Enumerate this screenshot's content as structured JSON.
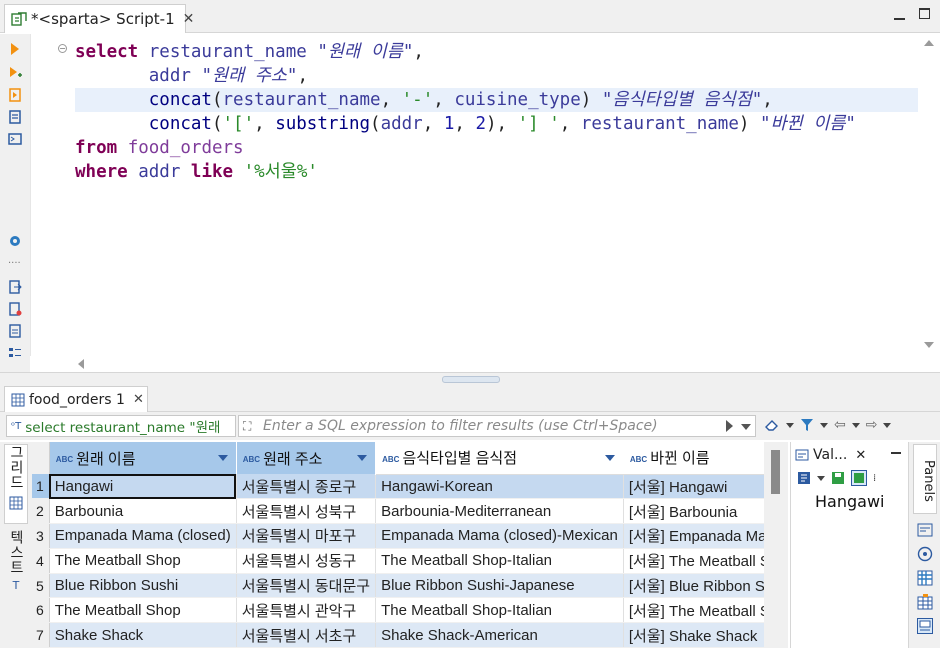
{
  "editor_tab": {
    "title": "*<sparta> Script-1",
    "close": "✕"
  },
  "sql": {
    "lines": [
      [
        {
          "t": "select",
          "c": "kw"
        },
        {
          "t": " restaurant_name ",
          "c": "id"
        },
        {
          "t": "\"원래 이름\"",
          "c": "alias"
        },
        {
          "t": ",",
          "c": "pl"
        }
      ],
      [
        {
          "t": "       addr ",
          "c": "id"
        },
        {
          "t": "\"원래 주소\"",
          "c": "alias"
        },
        {
          "t": ",",
          "c": "pl"
        }
      ],
      [
        {
          "t": "       concat",
          "c": "fn"
        },
        {
          "t": "(",
          "c": "pl"
        },
        {
          "t": "restaurant_name",
          "c": "id"
        },
        {
          "t": ", ",
          "c": "pl"
        },
        {
          "t": "'-'",
          "c": "str"
        },
        {
          "t": ", ",
          "c": "pl"
        },
        {
          "t": "cuisine_type",
          "c": "id"
        },
        {
          "t": ") ",
          "c": "pl"
        },
        {
          "t": "\"음식타입별 음식점\"",
          "c": "alias"
        },
        {
          "t": ",",
          "c": "pl"
        }
      ],
      [
        {
          "t": "       concat",
          "c": "fn"
        },
        {
          "t": "(",
          "c": "pl"
        },
        {
          "t": "'['",
          "c": "str"
        },
        {
          "t": ", ",
          "c": "pl"
        },
        {
          "t": "substring",
          "c": "fn"
        },
        {
          "t": "(",
          "c": "pl"
        },
        {
          "t": "addr",
          "c": "id"
        },
        {
          "t": ", ",
          "c": "pl"
        },
        {
          "t": "1",
          "c": "num"
        },
        {
          "t": ", ",
          "c": "pl"
        },
        {
          "t": "2",
          "c": "num"
        },
        {
          "t": "), ",
          "c": "pl"
        },
        {
          "t": "'] '",
          "c": "str"
        },
        {
          "t": ", ",
          "c": "pl"
        },
        {
          "t": "restaurant_name",
          "c": "id"
        },
        {
          "t": ") ",
          "c": "pl"
        },
        {
          "t": "\"바뀐 이름\"",
          "c": "alias"
        }
      ],
      [
        {
          "t": "from",
          "c": "kw"
        },
        {
          "t": " food_orders",
          "c": "tbl"
        }
      ],
      [
        {
          "t": "where",
          "c": "kw"
        },
        {
          "t": " addr ",
          "c": "id"
        },
        {
          "t": "like",
          "c": "kw"
        },
        {
          "t": " ",
          "c": "pl"
        },
        {
          "t": "'%서울%'",
          "c": "str"
        }
      ]
    ],
    "highlighted_line": 2
  },
  "results_tab": {
    "title": "food_orders 1",
    "close": "✕"
  },
  "filter": {
    "query_text": "select restaurant_name \"원래",
    "placeholder": "Enter a SQL expression to filter results (use Ctrl+Space)"
  },
  "side_tabs": {
    "grid": "그리드",
    "text": "텍스트"
  },
  "grid": {
    "columns": [
      "원래 이름",
      "원래 주소",
      "음식타입별 음식점",
      "바뀐 이름"
    ],
    "rows": [
      [
        "1",
        "Hangawi",
        "서울특별시 종로구",
        "Hangawi-Korean",
        "[서울] Hangawi"
      ],
      [
        "2",
        "Barbounia",
        "서울특별시 성북구",
        "Barbounia-Mediterranean",
        "[서울] Barbounia"
      ],
      [
        "3",
        "Empanada Mama (closed)",
        "서울특별시 마포구",
        "Empanada Mama (closed)-Mexican",
        "[서울] Empanada Mama (closed)"
      ],
      [
        "4",
        "The Meatball Shop",
        "서울특별시 성동구",
        "The Meatball Shop-Italian",
        "[서울] The Meatball Shop"
      ],
      [
        "5",
        "Blue Ribbon Sushi",
        "서울특별시 동대문구",
        "Blue Ribbon Sushi-Japanese",
        "[서울] Blue Ribbon Sushi"
      ],
      [
        "6",
        "The Meatball Shop",
        "서울특별시 관악구",
        "The Meatball Shop-Italian",
        "[서울] The Meatball Shop"
      ],
      [
        "7",
        "Shake Shack",
        "서울특별시 서초구",
        "Shake Shack-American",
        "[서울] Shake Shack"
      ]
    ],
    "selected_row": 0
  },
  "value_panel": {
    "tab": "Val...",
    "close": "✕",
    "value": "Hangawi"
  },
  "panels_label": "Panels",
  "colors": {
    "header": "#a6c8ea",
    "keyword": "#7f0055",
    "string": "#2a8a2a",
    "alt_row": "#dde8f5"
  }
}
